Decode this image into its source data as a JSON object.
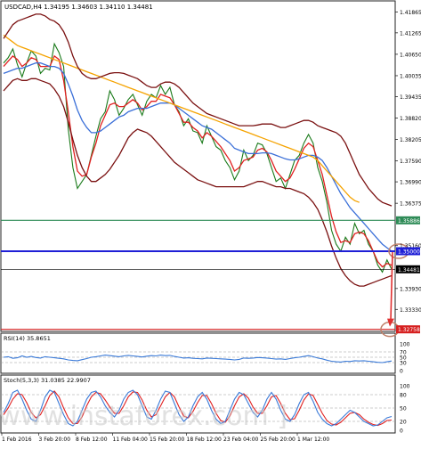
{
  "chart_data": {
    "type": "line",
    "instrument_title": "USDCAD,H4  1.34195 1.34603 1.34110 1.34481",
    "y_ticks": [
      "1.41865",
      "1.41265",
      "1.40650",
      "1.40035",
      "1.39435",
      "1.38820",
      "1.38205",
      "1.37590",
      "1.36990",
      "1.36375",
      "1.35160",
      "1.33930",
      "1.33330"
    ],
    "ylim": [
      1.3275,
      1.419
    ],
    "x_ticks": [
      "1 Feb 2016",
      "3 Feb 20:00",
      "8 Feb 12:00",
      "11 Feb 04:00",
      "15 Feb 20:00",
      "18 Feb 12:00",
      "23 Feb 04:00",
      "25 Feb 20:00",
      "1 Mar 12:00"
    ],
    "levels": [
      {
        "name": "resistance",
        "value": 1.35886,
        "label": "1.35886",
        "color": "#2e8b57"
      },
      {
        "name": "pivot",
        "value": 1.35,
        "label": "1.35000",
        "color": "#1f1fd6"
      },
      {
        "name": "current",
        "value": 1.34481,
        "label": "1.34481",
        "color": "#000000"
      },
      {
        "name": "target",
        "value": 1.32758,
        "label": "1.32758",
        "color": "#d62020"
      }
    ],
    "series": [
      {
        "kind": "price-close",
        "color": "#1a7a1a",
        "values": [
          1.404,
          1.4055,
          1.408,
          1.4035,
          1.4,
          1.404,
          1.4075,
          1.406,
          1.401,
          1.4025,
          1.402,
          1.4095,
          1.407,
          1.403,
          1.385,
          1.374,
          1.368,
          1.37,
          1.372,
          1.3775,
          1.383,
          1.388,
          1.39,
          1.396,
          1.3935,
          1.389,
          1.391,
          1.3935,
          1.395,
          1.392,
          1.389,
          1.393,
          1.395,
          1.394,
          1.3975,
          1.395,
          1.397,
          1.392,
          1.39,
          1.386,
          1.388,
          1.3845,
          1.384,
          1.381,
          1.386,
          1.383,
          1.38,
          1.379,
          1.376,
          1.374,
          1.3705,
          1.373,
          1.379,
          1.376,
          1.3775,
          1.381,
          1.3805,
          1.378,
          1.374,
          1.37,
          1.371,
          1.368,
          1.372,
          1.376,
          1.3775,
          1.381,
          1.3835,
          1.381,
          1.374,
          1.37,
          1.364,
          1.356,
          1.352,
          1.35,
          1.354,
          1.352,
          1.358,
          1.355,
          1.356,
          1.352,
          1.35,
          1.346,
          1.344,
          1.3475,
          1.3448
        ]
      },
      {
        "kind": "MA-fast",
        "color": "#e02020",
        "values": [
          1.403,
          1.4045,
          1.406,
          1.405,
          1.403,
          1.404,
          1.4055,
          1.405,
          1.403,
          1.403,
          1.403,
          1.406,
          1.405,
          1.399,
          1.39,
          1.38,
          1.373,
          1.3715,
          1.372,
          1.377,
          1.381,
          1.386,
          1.389,
          1.392,
          1.3925,
          1.3915,
          1.3915,
          1.3925,
          1.3935,
          1.3925,
          1.3905,
          1.3915,
          1.393,
          1.393,
          1.395,
          1.3945,
          1.394,
          1.392,
          1.3895,
          1.387,
          1.387,
          1.3855,
          1.3845,
          1.3825,
          1.384,
          1.383,
          1.3815,
          1.38,
          1.378,
          1.376,
          1.373,
          1.374,
          1.376,
          1.3765,
          1.377,
          1.379,
          1.3795,
          1.3785,
          1.376,
          1.373,
          1.3715,
          1.37,
          1.371,
          1.3735,
          1.3765,
          1.3795,
          1.381,
          1.38,
          1.376,
          1.372,
          1.366,
          1.36,
          1.3555,
          1.3525,
          1.353,
          1.3525,
          1.355,
          1.3555,
          1.355,
          1.353,
          1.35,
          1.347,
          1.3455,
          1.3465,
          1.346
        ]
      },
      {
        "kind": "MA-mid",
        "color": "#3a6fd8",
        "values": [
          1.401,
          1.4015,
          1.402,
          1.4025,
          1.4025,
          1.403,
          1.4035,
          1.404,
          1.404,
          1.4035,
          1.403,
          1.403,
          1.4025,
          1.401,
          1.398,
          1.3945,
          1.3905,
          1.3875,
          1.3855,
          1.384,
          1.384,
          1.3845,
          1.3855,
          1.3865,
          1.3875,
          1.3885,
          1.389,
          1.39,
          1.3905,
          1.391,
          1.391,
          1.391,
          1.3915,
          1.392,
          1.3925,
          1.3925,
          1.3925,
          1.392,
          1.391,
          1.39,
          1.389,
          1.388,
          1.387,
          1.386,
          1.3855,
          1.385,
          1.384,
          1.383,
          1.382,
          1.381,
          1.3795,
          1.379,
          1.3785,
          1.378,
          1.378,
          1.378,
          1.3782,
          1.3782,
          1.378,
          1.3775,
          1.377,
          1.3765,
          1.3762,
          1.3762,
          1.3765,
          1.377,
          1.3775,
          1.3775,
          1.377,
          1.376,
          1.374,
          1.3715,
          1.369,
          1.3665,
          1.3645,
          1.3625,
          1.361,
          1.3595,
          1.358,
          1.3565,
          1.355,
          1.3535,
          1.352,
          1.351,
          1.35
        ]
      },
      {
        "kind": "MA-slow",
        "color": "#f5a300",
        "values": [
          1.412,
          1.411,
          1.41,
          1.409,
          1.4085,
          1.408,
          1.4075,
          1.407,
          1.4065,
          1.406,
          1.4055,
          1.405,
          1.4045,
          1.404,
          1.4035,
          1.403,
          1.4025,
          1.402,
          1.4015,
          1.401,
          1.4005,
          1.4,
          1.3995,
          1.399,
          1.3985,
          1.398,
          1.3975,
          1.397,
          1.3965,
          1.396,
          1.3955,
          1.395,
          1.3945,
          1.394,
          1.3935,
          1.393,
          1.3925,
          1.392,
          1.3915,
          1.391,
          1.3905,
          1.39,
          1.3895,
          1.389,
          1.3885,
          1.388,
          1.3875,
          1.387,
          1.3865,
          1.386,
          1.3855,
          1.385,
          1.3845,
          1.384,
          1.3835,
          1.383,
          1.3825,
          1.382,
          1.3815,
          1.381,
          1.3805,
          1.38,
          1.3795,
          1.379,
          1.3785,
          1.378,
          1.3775,
          1.377,
          1.376,
          1.3745,
          1.373,
          1.3715,
          1.37,
          1.3685,
          1.367,
          1.3655,
          1.3645,
          1.364,
          null,
          null,
          null,
          null,
          null,
          null,
          null
        ]
      },
      {
        "kind": "BB-upper",
        "color": "#7a1010",
        "values": [
          1.411,
          1.413,
          1.415,
          1.416,
          1.4165,
          1.417,
          1.4175,
          1.418,
          1.418,
          1.4175,
          1.4165,
          1.416,
          1.415,
          1.413,
          1.41,
          1.406,
          1.403,
          1.401,
          1.4,
          1.3995,
          1.3995,
          1.4,
          1.4005,
          1.401,
          1.4012,
          1.4012,
          1.401,
          1.4005,
          1.4,
          1.3995,
          1.3985,
          1.3975,
          1.397,
          1.397,
          1.398,
          1.3985,
          1.3985,
          1.398,
          1.397,
          1.3955,
          1.394,
          1.3925,
          1.3915,
          1.3905,
          1.3895,
          1.389,
          1.3885,
          1.388,
          1.3875,
          1.387,
          1.3865,
          1.386,
          1.386,
          1.386,
          1.386,
          1.3862,
          1.3865,
          1.3865,
          1.3865,
          1.386,
          1.3855,
          1.3855,
          1.386,
          1.3865,
          1.387,
          1.3875,
          1.3875,
          1.387,
          1.386,
          1.3855,
          1.385,
          1.3845,
          1.384,
          1.383,
          1.381,
          1.378,
          1.375,
          1.372,
          1.37,
          1.368,
          1.3665,
          1.365,
          1.364,
          1.3635,
          1.363
        ]
      },
      {
        "kind": "BB-lower",
        "color": "#7a1010",
        "values": [
          1.396,
          1.3975,
          1.399,
          1.3995,
          1.399,
          1.399,
          1.3995,
          1.3995,
          1.399,
          1.3985,
          1.398,
          1.3965,
          1.3945,
          1.3915,
          1.387,
          1.382,
          1.3775,
          1.374,
          1.3715,
          1.37,
          1.37,
          1.371,
          1.372,
          1.3735,
          1.3755,
          1.3775,
          1.38,
          1.3825,
          1.384,
          1.385,
          1.3845,
          1.384,
          1.383,
          1.3815,
          1.38,
          1.3785,
          1.377,
          1.3755,
          1.3745,
          1.3735,
          1.3725,
          1.3715,
          1.3705,
          1.37,
          1.3695,
          1.369,
          1.3685,
          1.3685,
          1.3685,
          1.3685,
          1.3685,
          1.3685,
          1.3685,
          1.369,
          1.3695,
          1.37,
          1.37,
          1.3695,
          1.369,
          1.3685,
          1.3685,
          1.368,
          1.368,
          1.3675,
          1.367,
          1.3665,
          1.3655,
          1.364,
          1.362,
          1.359,
          1.3555,
          1.3515,
          1.348,
          1.345,
          1.343,
          1.3415,
          1.3405,
          1.34,
          1.34,
          1.3405,
          1.341,
          1.3415,
          1.342,
          1.3425,
          1.343
        ]
      }
    ],
    "annotations": {
      "arrow_from": 1.35,
      "arrow_to": 1.32758,
      "arrow_color": "#e03030",
      "circle_color": "#c0806a"
    },
    "rsi": {
      "label": "RSI(14) 35.8651",
      "ticks": [
        "100",
        "70",
        "50",
        "30",
        "0"
      ],
      "ylim": [
        0,
        100
      ],
      "color": "#3a7ad8",
      "values": [
        50,
        52,
        46,
        48,
        55,
        50,
        53,
        49,
        47,
        52,
        50,
        48,
        46,
        44,
        40,
        38,
        37,
        41,
        45,
        50,
        52,
        55,
        58,
        56,
        54,
        52,
        55,
        57,
        55,
        53,
        51,
        54,
        56,
        55,
        58,
        56,
        57,
        53,
        50,
        47,
        48,
        46,
        45,
        44,
        47,
        46,
        45,
        44,
        43,
        42,
        40,
        42,
        47,
        46,
        47,
        49,
        48,
        47,
        45,
        43,
        44,
        42,
        45,
        48,
        50,
        53,
        56,
        52,
        47,
        44,
        39,
        35,
        33,
        32,
        35,
        34,
        37,
        36,
        37,
        35,
        33,
        31,
        30,
        33,
        35.9
      ]
    },
    "stoch": {
      "label": "Stoch(5,3,3) 31.0385 22.9907",
      "ticks": [
        "100",
        "80",
        "50",
        "20",
        "0"
      ],
      "ylim": [
        0,
        100
      ],
      "colors": {
        "main": "#3a7ad8",
        "signal": "#e02020"
      },
      "main": [
        40,
        60,
        85,
        90,
        70,
        45,
        25,
        20,
        45,
        75,
        90,
        85,
        60,
        35,
        15,
        10,
        20,
        45,
        70,
        85,
        88,
        75,
        55,
        40,
        30,
        45,
        70,
        85,
        90,
        80,
        55,
        30,
        25,
        45,
        70,
        88,
        85,
        60,
        35,
        20,
        30,
        55,
        75,
        85,
        70,
        45,
        25,
        15,
        20,
        45,
        70,
        85,
        80,
        60,
        40,
        30,
        45,
        70,
        85,
        70,
        45,
        25,
        20,
        35,
        60,
        80,
        85,
        65,
        40,
        25,
        15,
        10,
        15,
        25,
        35,
        45,
        40,
        30,
        20,
        15,
        10,
        12,
        20,
        28,
        31.04
      ],
      "signal": [
        35,
        50,
        70,
        82,
        80,
        62,
        40,
        28,
        35,
        55,
        78,
        88,
        75,
        50,
        28,
        15,
        15,
        30,
        55,
        75,
        85,
        82,
        68,
        52,
        38,
        38,
        55,
        75,
        86,
        85,
        68,
        45,
        30,
        35,
        55,
        75,
        85,
        75,
        52,
        32,
        28,
        42,
        62,
        78,
        78,
        60,
        38,
        22,
        18,
        32,
        55,
        75,
        82,
        72,
        52,
        38,
        38,
        55,
        75,
        78,
        60,
        38,
        24,
        26,
        45,
        68,
        82,
        78,
        58,
        38,
        22,
        14,
        12,
        18,
        28,
        38,
        40,
        35,
        25,
        18,
        13,
        11,
        15,
        22,
        22.99
      ]
    },
    "watermark": "[ www.instaforex.com ]"
  }
}
